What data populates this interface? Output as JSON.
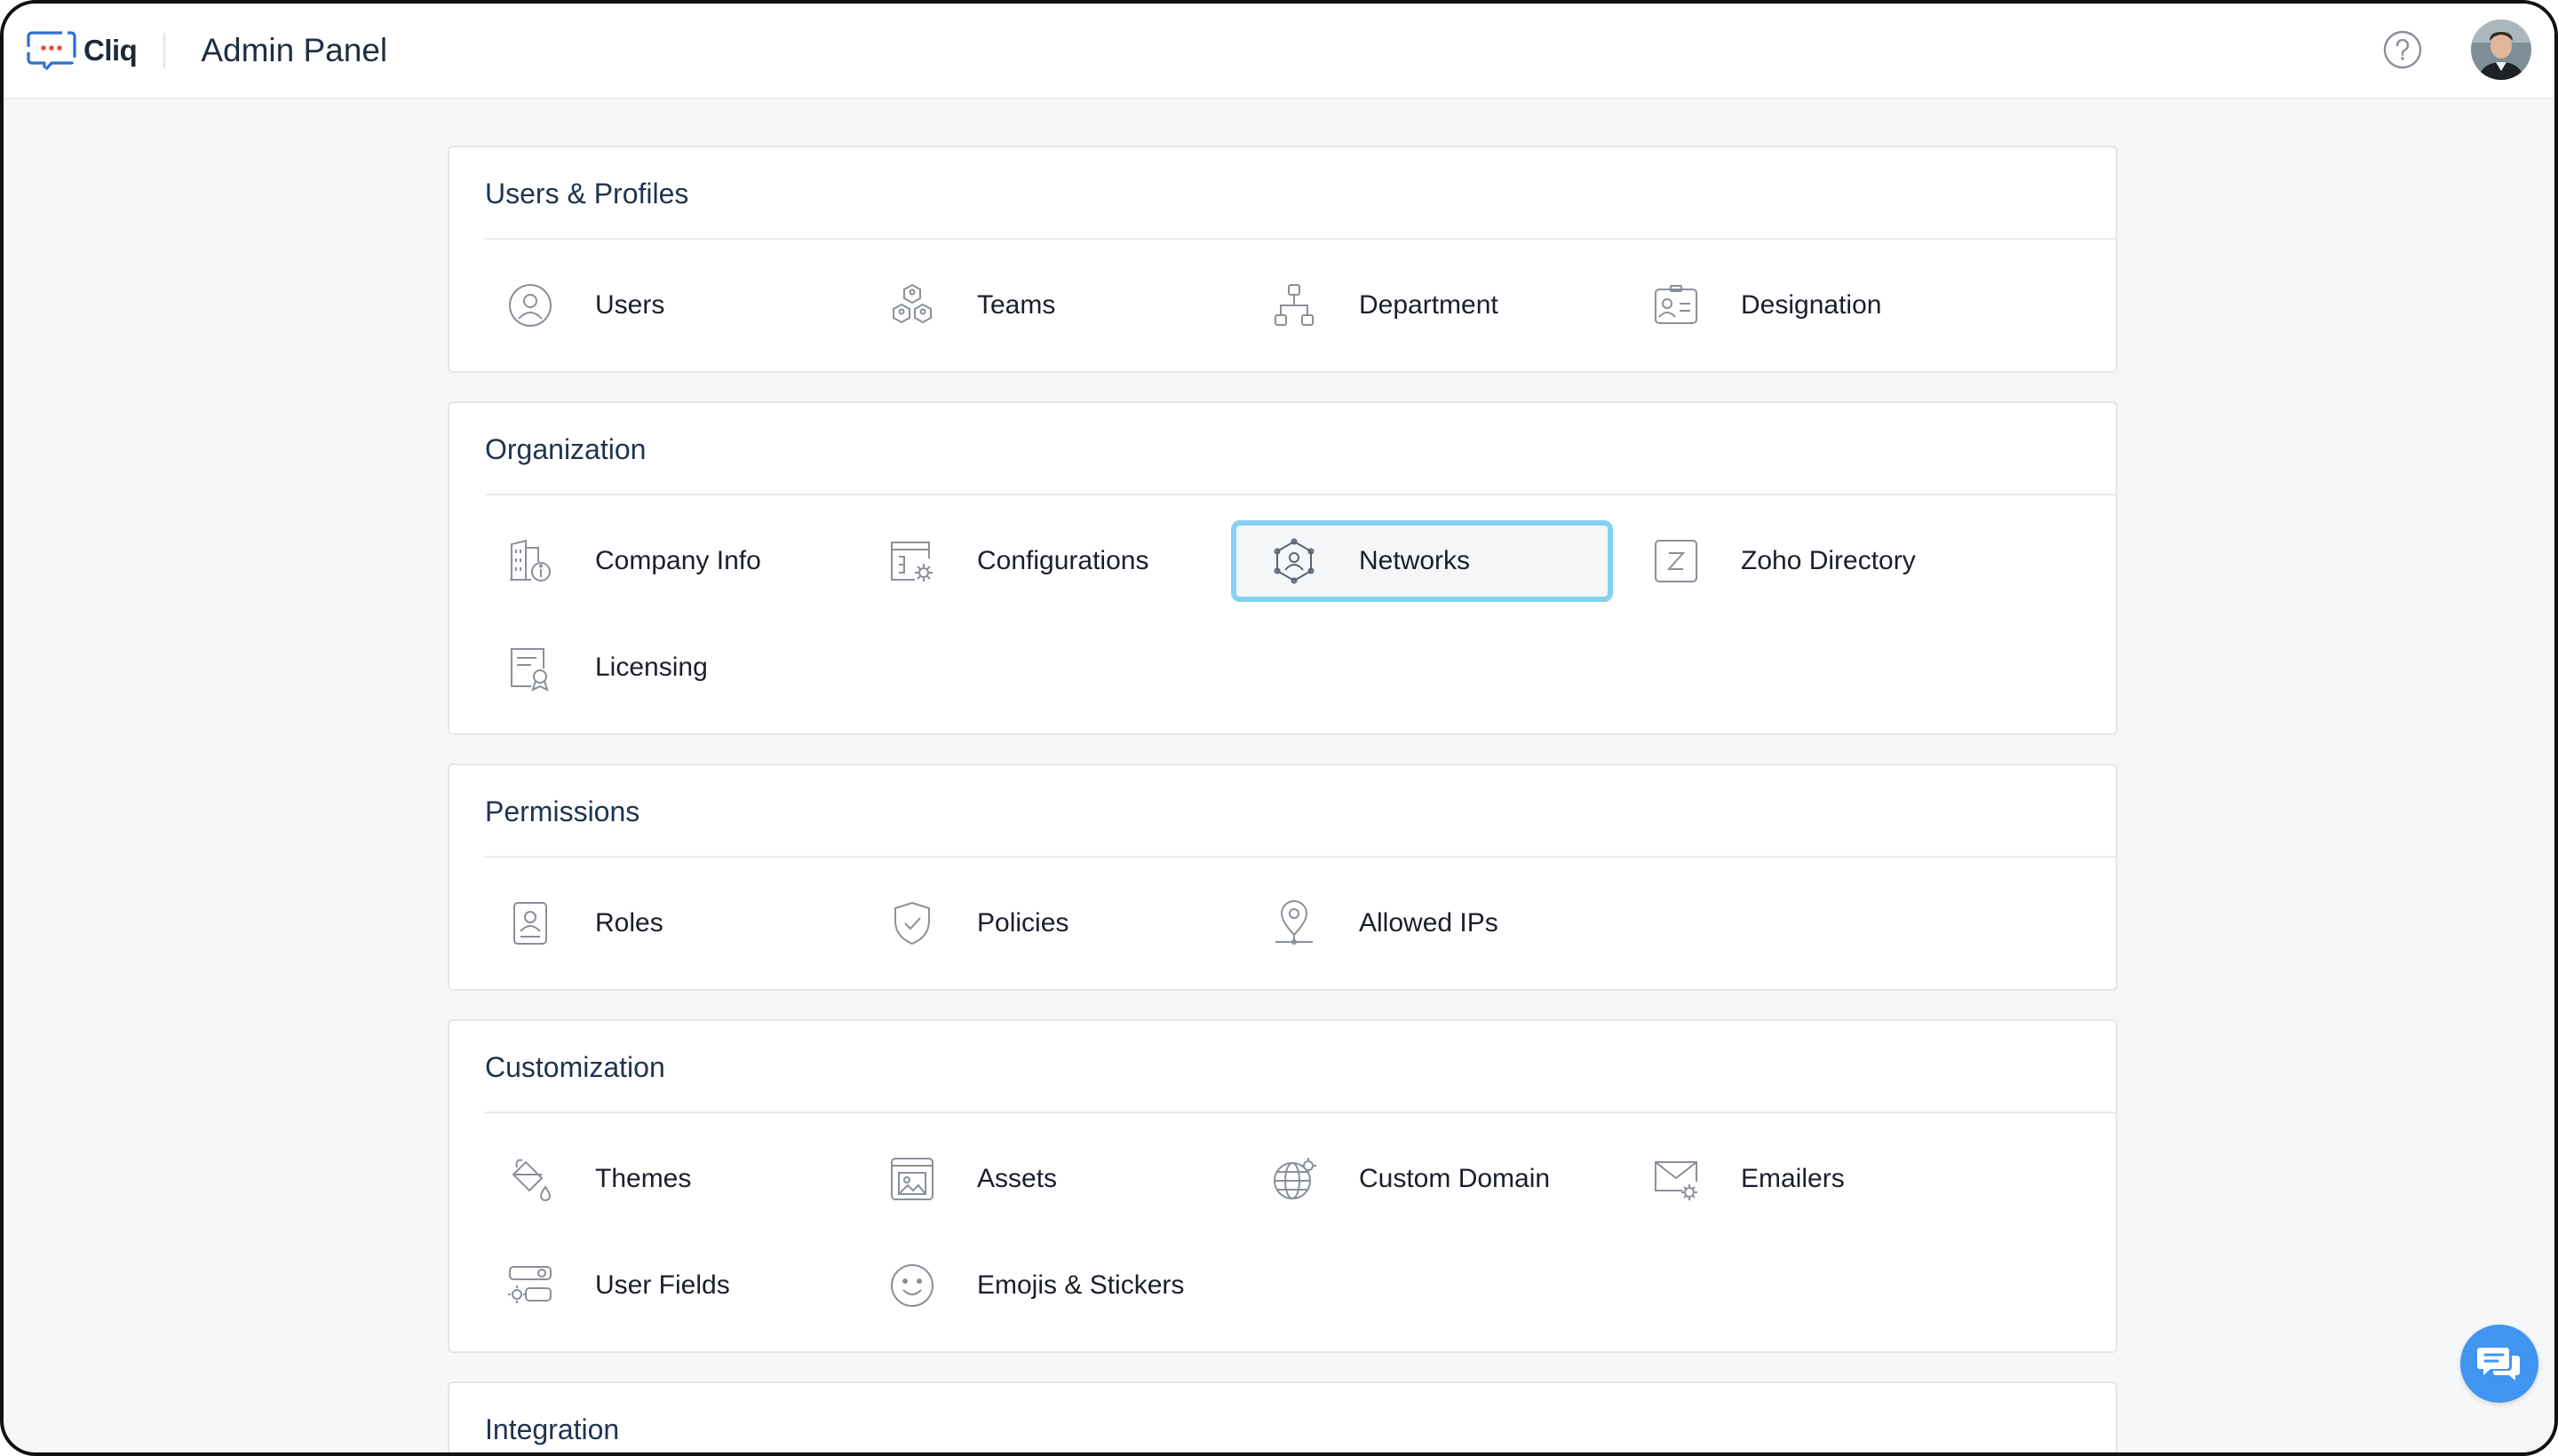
{
  "app": {
    "name": "Cliq",
    "panel_title": "Admin Panel"
  },
  "colors": {
    "accent": "#3f95f0",
    "selection_border": "#86d1f2",
    "logo_blue": "#2a6fd6",
    "logo_red": "#e0533d"
  },
  "sections": [
    {
      "title": "Users & Profiles",
      "items": [
        {
          "label": "Users",
          "icon": "user-circle-icon"
        },
        {
          "label": "Teams",
          "icon": "teams-icon"
        },
        {
          "label": "Department",
          "icon": "org-chart-icon"
        },
        {
          "label": "Designation",
          "icon": "id-badge-icon"
        }
      ]
    },
    {
      "title": "Organization",
      "items": [
        {
          "label": "Company Info",
          "icon": "building-info-icon"
        },
        {
          "label": "Configurations",
          "icon": "config-gear-icon"
        },
        {
          "label": "Networks",
          "icon": "network-icon",
          "selected": true
        },
        {
          "label": "Zoho Directory",
          "icon": "z-directory-icon"
        },
        {
          "label": "Licensing",
          "icon": "license-certificate-icon"
        }
      ]
    },
    {
      "title": "Permissions",
      "items": [
        {
          "label": "Roles",
          "icon": "role-badge-icon"
        },
        {
          "label": "Policies",
          "icon": "shield-check-icon"
        },
        {
          "label": "Allowed IPs",
          "icon": "location-pin-icon"
        }
      ]
    },
    {
      "title": "Customization",
      "items": [
        {
          "label": "Themes",
          "icon": "paint-bucket-icon"
        },
        {
          "label": "Assets",
          "icon": "image-asset-icon"
        },
        {
          "label": "Custom Domain",
          "icon": "globe-gear-icon"
        },
        {
          "label": "Emailers",
          "icon": "mail-gear-icon"
        },
        {
          "label": "User Fields",
          "icon": "toggle-fields-icon"
        },
        {
          "label": "Emojis & Stickers",
          "icon": "smiley-icon"
        }
      ]
    },
    {
      "title": "Integration",
      "items": []
    }
  ]
}
